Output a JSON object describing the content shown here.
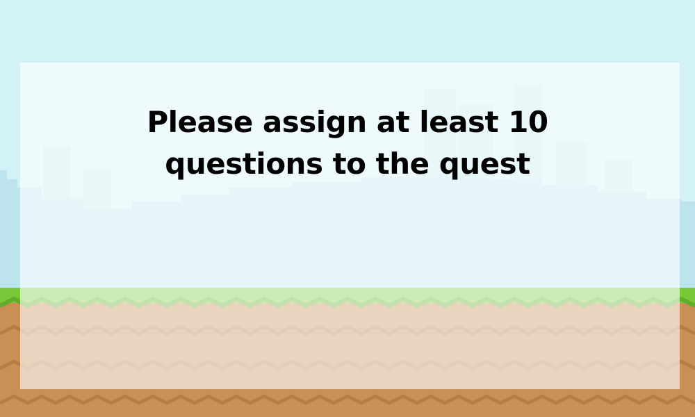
{
  "message": {
    "line1": "Please assign at least 10",
    "line2": "questions to the quest"
  },
  "colors": {
    "sky": "#d2f2f7",
    "hills": "#bde4ec",
    "city": "#c9e9ef",
    "grass": "#78c83a",
    "dirt": "#c98f54",
    "dirt_dark": "#b77c45",
    "overlay": "rgba(255,255,255,0.62)",
    "text": "#000000"
  }
}
